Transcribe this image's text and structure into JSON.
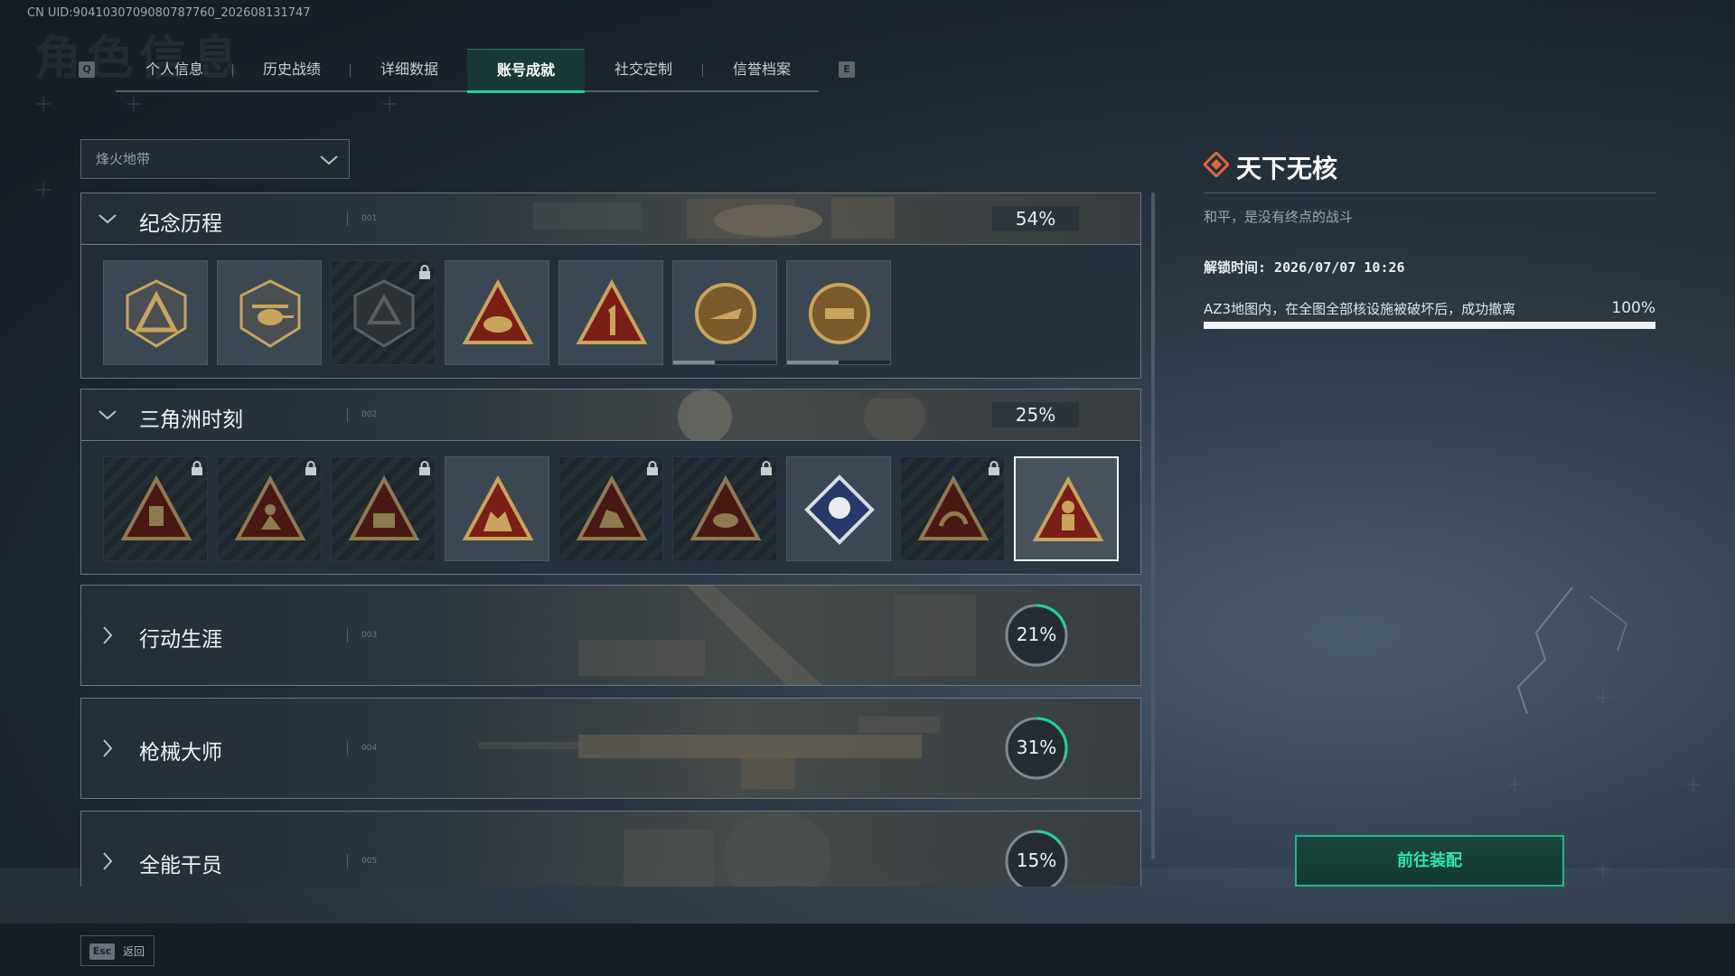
{
  "uid_text": "CN UID:9041030709080787760_202608131747",
  "page_heading": "角色信息",
  "tabs": {
    "left_key": "Q",
    "right_key": "E",
    "items": [
      "个人信息",
      "历史战绩",
      "详细数据",
      "账号成就",
      "社交定制",
      "信誉档案"
    ],
    "active_index": 3
  },
  "dropdown": {
    "value": "烽火地带"
  },
  "sections": [
    {
      "title": "纪念历程",
      "number": "001",
      "percent": "54%",
      "expanded": true,
      "badges": [
        {
          "icon": "delta-shield-emblem",
          "locked": false,
          "selected": false,
          "progress": null
        },
        {
          "icon": "helicopter-shield-emblem",
          "locked": false,
          "selected": false,
          "progress": null
        },
        {
          "icon": "dark-shield-emblem",
          "locked": true,
          "selected": false,
          "progress": null
        },
        {
          "icon": "bird-triangle-emblem",
          "locked": false,
          "selected": false,
          "progress": null
        },
        {
          "icon": "number-one-triangle-emblem",
          "locked": false,
          "selected": false,
          "progress": null
        },
        {
          "icon": "delta-force-round-emblem",
          "locked": false,
          "selected": false,
          "progress": 0.4
        },
        {
          "icon": "delta-force-2026-emblem",
          "locked": false,
          "selected": false,
          "progress": 0.5
        }
      ]
    },
    {
      "title": "三角洲时刻",
      "number": "002",
      "percent": "25%",
      "expanded": true,
      "badges": [
        {
          "icon": "soldier-triangle-emblem",
          "locked": true,
          "selected": false
        },
        {
          "icon": "crouching-soldier-triangle-emblem",
          "locked": true,
          "selected": false
        },
        {
          "icon": "chest-triangle-emblem",
          "locked": true,
          "selected": false
        },
        {
          "icon": "squad-triangle-emblem",
          "locked": false,
          "selected": false
        },
        {
          "icon": "beast-triangle-emblem",
          "locked": true,
          "selected": false
        },
        {
          "icon": "bird-dark-triangle-emblem",
          "locked": true,
          "selected": false
        },
        {
          "icon": "rose-diamond-emblem",
          "locked": false,
          "selected": false
        },
        {
          "icon": "dragon-triangle-emblem",
          "locked": true,
          "selected": false
        },
        {
          "icon": "hazmat-triangle-emblem",
          "locked": false,
          "selected": true
        }
      ]
    },
    {
      "title": "行动生涯",
      "number": "003",
      "percent": "21%",
      "percent_value": 0.21,
      "expanded": false
    },
    {
      "title": "枪械大师",
      "number": "004",
      "percent": "31%",
      "percent_value": 0.31,
      "expanded": false
    },
    {
      "title": "全能干员",
      "number": "005",
      "percent": "15%",
      "percent_value": 0.15,
      "expanded": false
    }
  ],
  "detail": {
    "title": "天下无核",
    "description": "和平，是没有终点的战斗",
    "unlock_time": "解锁时间: 2026/07/07 10:26",
    "condition": "AZ3地图内，在全图全部核设施被破坏后，成功撤离",
    "condition_percent": "100%",
    "condition_progress": 1.0,
    "button_label": "前往装配"
  },
  "footer": {
    "esc_key": "Esc",
    "esc_label": "返回"
  },
  "colors": {
    "accent": "#1ed39a",
    "badge_gold": "#c9a45c",
    "badge_red": "#7a1e16",
    "title_icon": "#e0683a"
  }
}
